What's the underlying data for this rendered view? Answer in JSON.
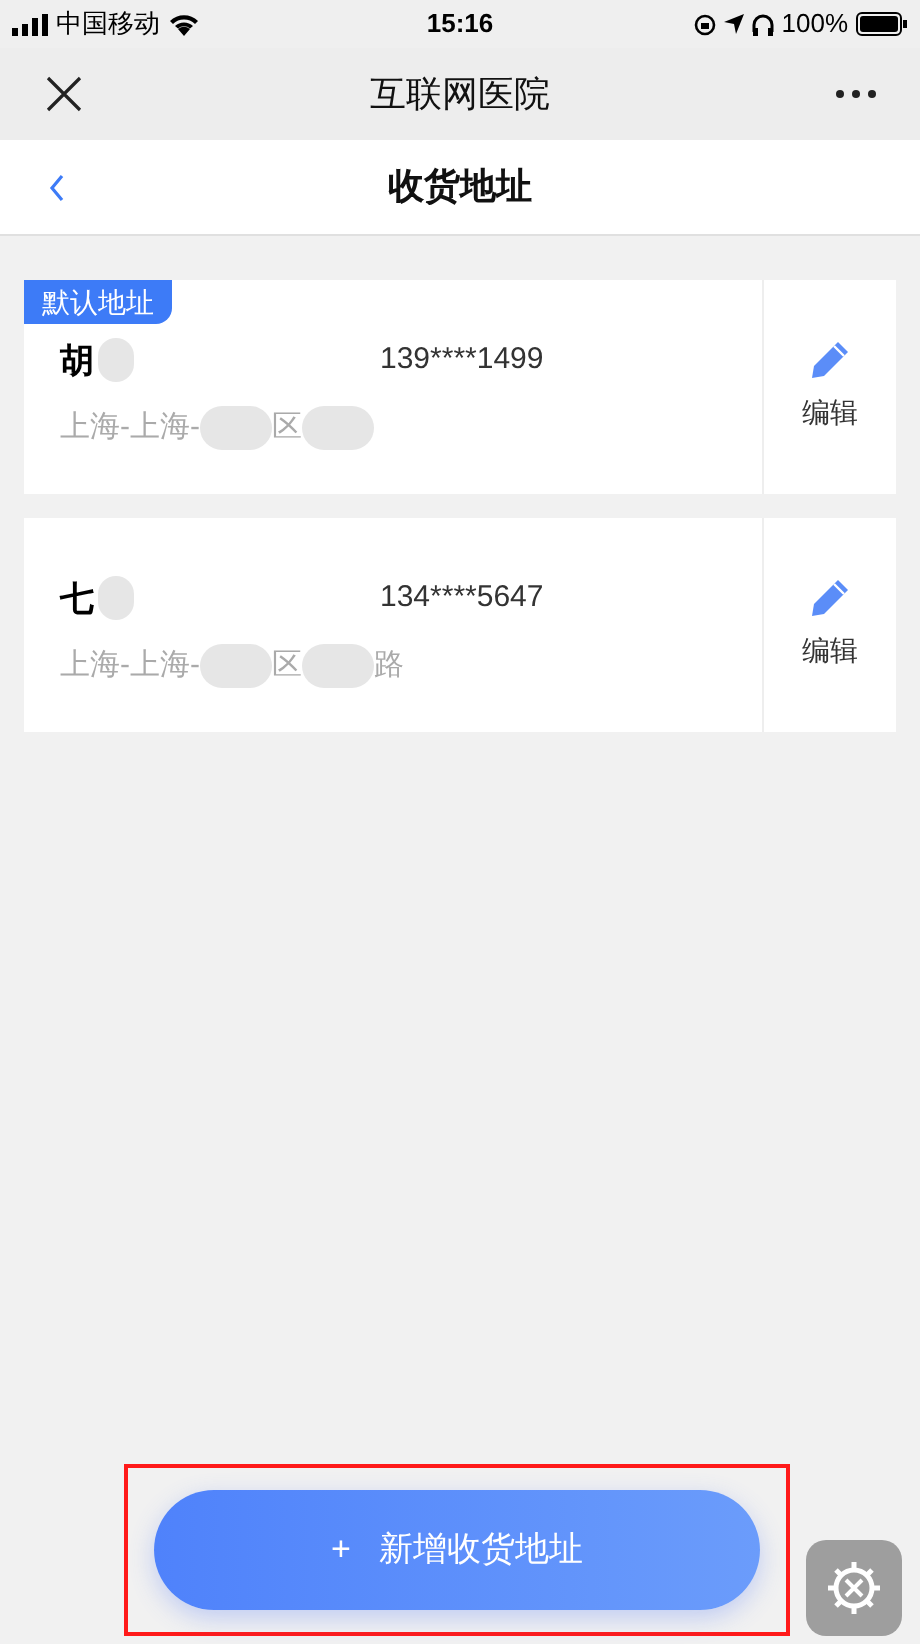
{
  "status_bar": {
    "carrier": "中国移动",
    "time": "15:16",
    "battery": "100%"
  },
  "app_bar": {
    "title": "互联网医院"
  },
  "header": {
    "title": "收货地址"
  },
  "addresses": [
    {
      "is_default": true,
      "badge": "默认地址",
      "name": "胡",
      "phone": "139****1499",
      "address_parts": [
        "上海-上海-",
        "区"
      ],
      "edit": "编辑"
    },
    {
      "is_default": false,
      "name": "七",
      "phone": "134****5647",
      "address_parts": [
        "上海-上海-",
        "区",
        "路"
      ],
      "edit": "编辑"
    }
  ],
  "add_button": {
    "icon": "+",
    "label": "新增收货地址",
    "highlighted": true
  }
}
